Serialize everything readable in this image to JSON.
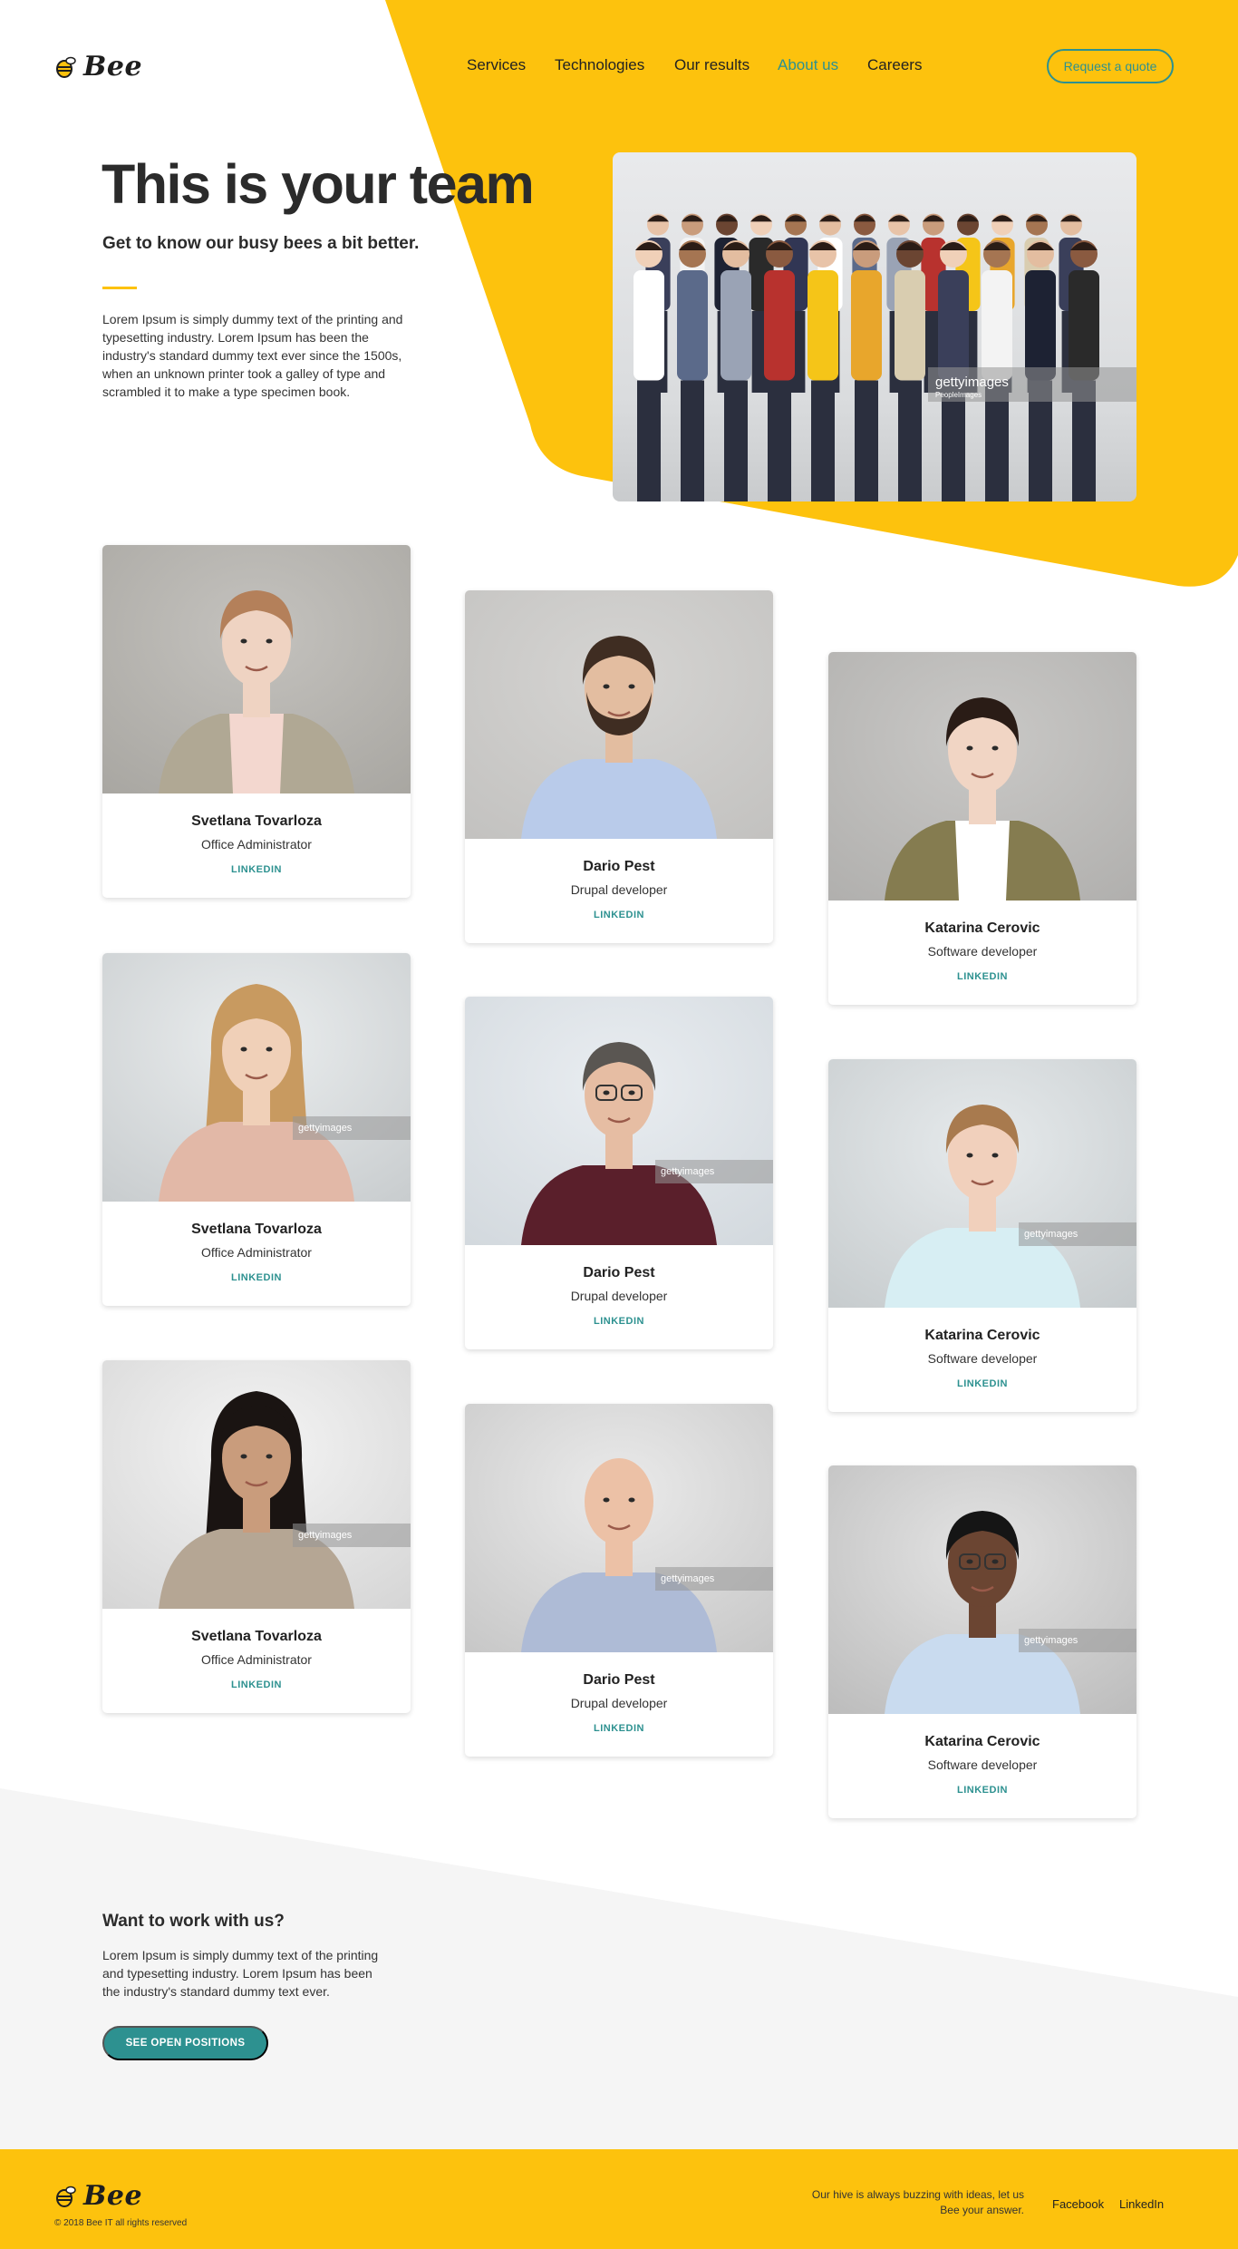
{
  "brand": {
    "name": "Bee",
    "colors": {
      "yellow": "#fdc20d",
      "teal": "#2d9190",
      "dark": "#2b2b2b",
      "light_gray": "#f5f5f5"
    }
  },
  "nav": {
    "items": [
      {
        "label": "Services",
        "active": false
      },
      {
        "label": "Technologies",
        "active": false
      },
      {
        "label": "Our results",
        "active": false
      },
      {
        "label": "About us",
        "active": true
      },
      {
        "label": "Careers",
        "active": false
      }
    ],
    "cta": "Request a quote"
  },
  "hero": {
    "title": "This is your team",
    "subtitle": "Get to know our busy bees a bit better.",
    "body": "Lorem Ipsum is simply dummy text of the printing and typesetting industry. Lorem Ipsum has been the industry's standard dummy text ever since the 1500s, when an unknown printer took a galley of type and scrambled it to make a type specimen book.",
    "photo_watermark": "gettyimages",
    "photo_watermark_sub": "PeopleImages"
  },
  "team": [
    {
      "name": "Svetlana Tovarloza",
      "role": "Office Administrator",
      "link": "LINKEDIN",
      "watermark": ""
    },
    {
      "name": "Dario Pest",
      "role": "Drupal developer",
      "link": "LINKEDIN",
      "watermark": ""
    },
    {
      "name": "Katarina Cerovic",
      "role": "Software developer",
      "link": "LINKEDIN",
      "watermark": ""
    },
    {
      "name": "Svetlana Tovarloza",
      "role": "Office Administrator",
      "link": "LINKEDIN",
      "watermark": "gettyimages"
    },
    {
      "name": "Dario Pest",
      "role": "Drupal developer",
      "link": "LINKEDIN",
      "watermark": "gettyimages"
    },
    {
      "name": "Katarina Cerovic",
      "role": "Software developer",
      "link": "LINKEDIN",
      "watermark": "gettyimages"
    },
    {
      "name": "Svetlana Tovarloza",
      "role": "Office Administrator",
      "link": "LINKEDIN",
      "watermark": "gettyimages"
    },
    {
      "name": "Dario Pest",
      "role": "Drupal developer",
      "link": "LINKEDIN",
      "watermark": "gettyimages"
    },
    {
      "name": "Katarina Cerovic",
      "role": "Software developer",
      "link": "LINKEDIN",
      "watermark": "gettyimages"
    }
  ],
  "careers": {
    "title": "Want to work with us?",
    "body": "Lorem Ipsum is simply dummy text of the printing and typesetting industry. Lorem Ipsum has been the industry's standard dummy text ever.",
    "button": "SEE OPEN POSITIONS"
  },
  "footer": {
    "copyright": "© 2018 Bee IT all rights reserved",
    "tagline": "Our hive is always buzzing with ideas, let us Bee your answer.",
    "links": [
      "Facebook",
      "LinkedIn"
    ]
  }
}
